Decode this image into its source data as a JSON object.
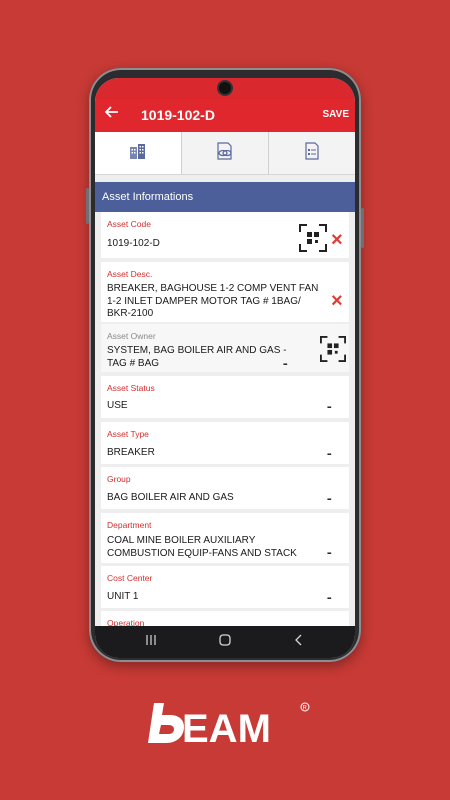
{
  "header": {
    "back_icon": "back-arrow-icon",
    "title": "1019-102-D",
    "save_label": "SAVE"
  },
  "tabs": [
    {
      "icon": "buildings-icon",
      "active": true
    },
    {
      "icon": "link-document-icon",
      "active": false
    },
    {
      "icon": "list-document-icon",
      "active": false
    }
  ],
  "section": {
    "title": "Asset Informations"
  },
  "fields": {
    "asset_code": {
      "label": "Asset Code",
      "value": "1019-102-D"
    },
    "asset_desc": {
      "label": "Asset Desc.",
      "value": "BREAKER, BAGHOUSE 1-2 COMP VENT FAN\n1-2 INLET DAMPER MOTOR  TAG # 1BAG/\nBKR-2100"
    },
    "asset_owner": {
      "label": "Asset Owner",
      "value": "SYSTEM, BAG BOILER AIR AND GAS -\nTAG # BAG"
    },
    "asset_status": {
      "label": "Asset Status",
      "value": "USE"
    },
    "asset_type": {
      "label": "Asset Type",
      "value": "BREAKER"
    },
    "group": {
      "label": "Group",
      "value": "BAG BOILER AIR AND GAS"
    },
    "department": {
      "label": "Department",
      "value": "COAL MINE BOILER AUXILIARY\nCOMBUSTION EQUIP-FANS AND STACK"
    },
    "cost_center": {
      "label": "Cost Center",
      "value": "UNIT 1"
    },
    "operation": {
      "label": "Operation",
      "value": ""
    }
  },
  "icons": {
    "clear": "×",
    "more": "▪▪▪"
  },
  "navbar": {
    "recent": "|||",
    "home": "◯",
    "back": "<"
  },
  "brand": {
    "name": "BEAM",
    "registered": "®"
  },
  "colors": {
    "background": "#c83a35",
    "appbar": "#e0272e",
    "section": "#4d5f9b",
    "label": "#d32f2f"
  }
}
